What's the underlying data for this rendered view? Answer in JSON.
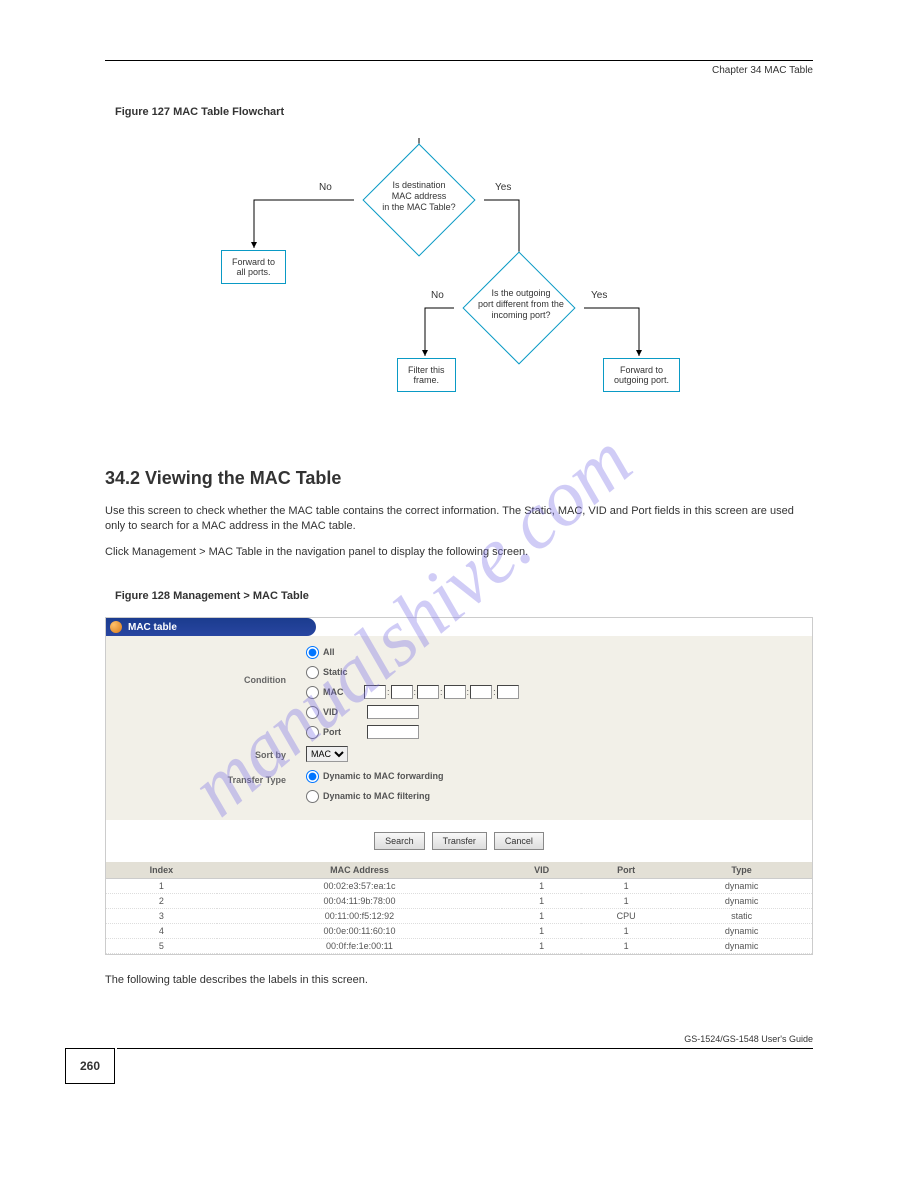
{
  "chapter_header": "Chapter 34 MAC Table",
  "figure1_caption": "Figure 127   MAC Table Flowchart",
  "flowchart": {
    "decision1": "Is destination\nMAC address\nin the MAC Table?",
    "decision2": "Is the outgoing\nport different from the\nincoming port?",
    "no1": "No",
    "yes1": "Yes",
    "no2": "No",
    "yes2": "Yes",
    "box_fwd_all": "Forward to\nall ports.",
    "box_filter": "Filter this\nframe.",
    "box_fwd_out": "Forward to\noutgoing port."
  },
  "section_title": "34.2  Viewing the MAC Table",
  "body": [
    "Use this screen to check whether the MAC table contains the correct information. The Static, MAC, VID and Port fields in this screen are used only to search for a MAC address in the MAC table.",
    "Click Management > MAC Table in the navigation panel to display the following screen."
  ],
  "figure2_caption": "Figure 128   Management > MAC Table",
  "screenshot": {
    "title": "MAC table",
    "labels": {
      "condition": "Condition",
      "sortby": "Sort by",
      "transfer_type": "Transfer Type"
    },
    "radios": {
      "all": "All",
      "static": "Static",
      "mac": "MAC",
      "vid": "VID",
      "port": "Port",
      "dyn_fwd": "Dynamic to MAC forwarding",
      "dyn_flt": "Dynamic to MAC filtering"
    },
    "sort_value": "MAC",
    "buttons": {
      "search": "Search",
      "transfer": "Transfer",
      "cancel": "Cancel"
    },
    "columns": [
      "Index",
      "MAC Address",
      "VID",
      "Port",
      "Type"
    ],
    "rows": [
      {
        "index": "1",
        "mac": "00:02:e3:57:ea:1c",
        "vid": "1",
        "port": "1",
        "type": "dynamic"
      },
      {
        "index": "2",
        "mac": "00:04:11:9b:78:00",
        "vid": "1",
        "port": "1",
        "type": "dynamic"
      },
      {
        "index": "3",
        "mac": "00:11:00:f5:12:92",
        "vid": "1",
        "port": "CPU",
        "type": "static"
      },
      {
        "index": "4",
        "mac": "00:0e:00:11:60:10",
        "vid": "1",
        "port": "1",
        "type": "dynamic"
      },
      {
        "index": "5",
        "mac": "00:0f:fe:1e:00:11",
        "vid": "1",
        "port": "1",
        "type": "dynamic"
      }
    ]
  },
  "following_text": "The following table describes the labels in this screen.",
  "page_number": "260",
  "footer_text": "GS-1524/GS-1548 User's Guide",
  "watermark": "manualshive.com"
}
